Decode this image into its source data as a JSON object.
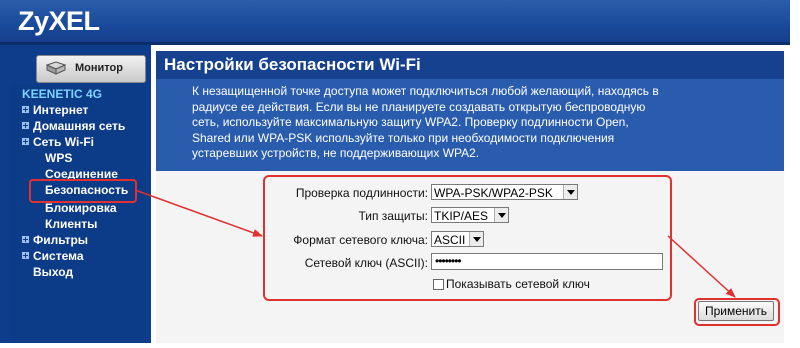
{
  "brand": {
    "logo": "ZyXEL"
  },
  "sidebar": {
    "monitor_label": "Монитор",
    "device_label": "KEENETIC 4G",
    "items": [
      {
        "label": "Интернет",
        "expandable": true
      },
      {
        "label": "Домашняя сеть",
        "expandable": true
      },
      {
        "label": "Сеть Wi-Fi",
        "expandable": true,
        "expanded": true
      },
      {
        "label": "WPS",
        "sub": true
      },
      {
        "label": "Соединение",
        "sub": true
      },
      {
        "label": "Безопасность",
        "sub": true,
        "selected": true
      },
      {
        "label": "Блокировка",
        "sub": true
      },
      {
        "label": "Клиенты",
        "sub": true
      },
      {
        "label": "Фильтры",
        "expandable": true
      },
      {
        "label": "Система",
        "expandable": true
      },
      {
        "label": "Выход"
      }
    ]
  },
  "page": {
    "title": "Настройки безопасности Wi-Fi",
    "description_lines": [
      "К незащищенной точке доступа может подключиться любой желающий, находясь в",
      "радиусе ее действия. Если вы не планируете создавать открытую беспроводную",
      "сеть, используйте максимальную защиту WPA2. Проверку подлинности Open,",
      "Shared или WPA-PSK используйте только при необходимости подключения",
      "устаревших устройств, не поддерживающих WPA2."
    ]
  },
  "form": {
    "auth_label": "Проверка подлинности:",
    "auth_value": "WPA-PSK/WPA2-PSK",
    "protection_label": "Тип защиты:",
    "protection_value": "TKIP/AES",
    "key_format_label": "Формат сетевого ключа:",
    "key_format_value": "ASCII",
    "key_label": "Сетевой ключ (ASCII):",
    "key_value": "••••••••",
    "show_key_label": "Показывать сетевой ключ",
    "show_key_checked": false,
    "apply_label": "Применить"
  },
  "colors": {
    "header_blue": "#1a4a9b",
    "sidebar_blue": "#0c3b88",
    "description_blue": "#2a5cae",
    "annotation_red": "#e03030"
  }
}
